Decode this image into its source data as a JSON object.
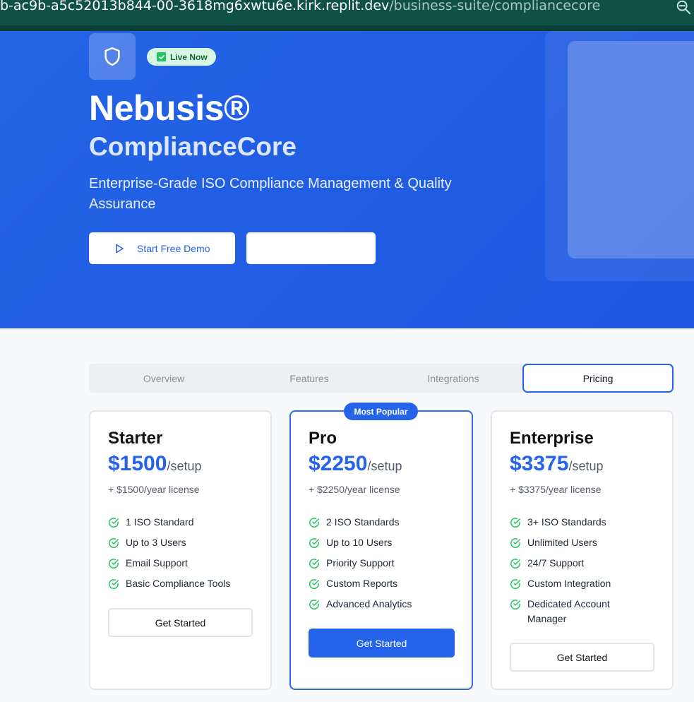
{
  "browser": {
    "url_host": "b-ac9b-a5c52013b844-00-3618mg6xwtu6e.kirk.replit.dev",
    "url_path": "/business-suite/compliancecore"
  },
  "hero": {
    "badge": "Live Now",
    "title": "Nebusis®",
    "subtitle": "ComplianceCore",
    "tagline": "Enterprise-Grade ISO Compliance Management & Quality Assurance",
    "demo_button": "Start Free Demo",
    "secondary_button": ""
  },
  "tabs": [
    {
      "label": "Overview",
      "active": false
    },
    {
      "label": "Features",
      "active": false
    },
    {
      "label": "Integrations",
      "active": false
    },
    {
      "label": "Pricing",
      "active": true
    }
  ],
  "plans": [
    {
      "name": "Starter",
      "price": "$1500",
      "unit": "/setup",
      "license": "+ $1500/year license",
      "features": [
        "1 ISO Standard",
        "Up to 3 Users",
        "Email Support",
        "Basic Compliance Tools"
      ],
      "cta": "Get Started"
    },
    {
      "name": "Pro",
      "badge": "Most Popular",
      "price": "$2250",
      "unit": "/setup",
      "license": "+ $2250/year license",
      "features": [
        "2 ISO Standards",
        "Up to 10 Users",
        "Priority Support",
        "Custom Reports",
        "Advanced Analytics"
      ],
      "cta": "Get Started"
    },
    {
      "name": "Enterprise",
      "price": "$3375",
      "unit": "/setup",
      "license": "+ $3375/year license",
      "features": [
        "3+ ISO Standards",
        "Unlimited Users",
        "24/7 Support",
        "Custom Integration",
        "Dedicated Account Manager"
      ],
      "cta": "Get Started"
    }
  ],
  "colors": {
    "accent": "#2563eb",
    "hero_bg": "#1e5ae2",
    "check_green": "#22c55e",
    "badge_bg": "#d7f7e4"
  },
  "icons": {
    "hero_icon": "shield-icon",
    "badge_icon": "check-square-icon",
    "demo_icon": "play-icon",
    "feature_icon": "check-circle-icon",
    "browser_icon": "zoom-out-icon"
  }
}
